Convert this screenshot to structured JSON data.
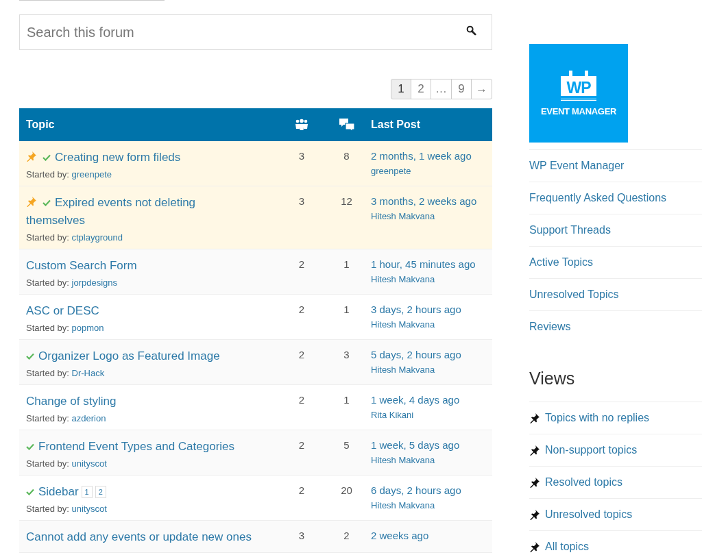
{
  "search": {
    "placeholder": "Search this forum"
  },
  "pagination": [
    {
      "label": "1",
      "selected": true
    },
    {
      "label": "2",
      "selected": false
    },
    {
      "label": "…",
      "selected": false
    },
    {
      "label": "9",
      "selected": false
    },
    {
      "label": "→",
      "selected": false
    }
  ],
  "table": {
    "columns": {
      "topic": "Topic",
      "last_post": "Last Post"
    },
    "rows": [
      {
        "title": "Creating new form fileds",
        "sticky": true,
        "resolved": true,
        "started_by": "Started by:",
        "author": "greenpete",
        "voices": "3",
        "posts": "8",
        "last_post": "2 months, 1 week ago",
        "last_post_author": "greenpete"
      },
      {
        "title": "Expired events not deleting themselves",
        "sticky": true,
        "resolved": true,
        "started_by": "Started by:",
        "author": "ctplayground",
        "voices": "3",
        "posts": "12",
        "last_post": "3 months, 2 weeks ago",
        "last_post_author": "Hitesh Makvana"
      },
      {
        "title": "Custom Search Form",
        "sticky": false,
        "resolved": false,
        "started_by": "Started by:",
        "author": "jorpdesigns",
        "voices": "2",
        "posts": "1",
        "last_post": "1 hour, 45 minutes ago",
        "last_post_author": "Hitesh Makvana"
      },
      {
        "title": "ASC or DESC",
        "sticky": false,
        "resolved": false,
        "started_by": "Started by:",
        "author": "popmon",
        "voices": "2",
        "posts": "1",
        "last_post": "3 days, 2 hours ago",
        "last_post_author": "Hitesh Makvana"
      },
      {
        "title": "Organizer Logo as Featured Image",
        "sticky": false,
        "resolved": true,
        "started_by": "Started by:",
        "author": "Dr-Hack",
        "voices": "2",
        "posts": "3",
        "last_post": "5 days, 2 hours ago",
        "last_post_author": "Hitesh Makvana"
      },
      {
        "title": "Change of styling",
        "sticky": false,
        "resolved": false,
        "started_by": "Started by:",
        "author": "azderion",
        "voices": "2",
        "posts": "1",
        "last_post": "1 week, 4 days ago",
        "last_post_author": "Rita Kikani"
      },
      {
        "title": "Frontend Event Types and Categories",
        "sticky": false,
        "resolved": true,
        "started_by": "Started by:",
        "author": "unityscot",
        "voices": "2",
        "posts": "5",
        "last_post": "1 week, 5 days ago",
        "last_post_author": "Hitesh Makvana"
      },
      {
        "title": "Sidebar",
        "sticky": false,
        "resolved": true,
        "pages": [
          "1",
          "2"
        ],
        "started_by": "Started by:",
        "author": "unityscot",
        "voices": "2",
        "posts": "20",
        "last_post": "6 days, 2 hours ago",
        "last_post_author": "Hitesh Makvana"
      },
      {
        "title": "Cannot add any events or update new ones",
        "sticky": false,
        "resolved": false,
        "voices": "3",
        "posts": "2",
        "last_post": "2 weeks ago"
      }
    ]
  },
  "sidebar": {
    "logo": {
      "mark": "WP",
      "name": "EVENT MANAGER"
    },
    "links": [
      "WP Event Manager",
      "Frequently Asked Questions",
      "Support Threads",
      "Active Topics",
      "Unresolved Topics",
      "Reviews"
    ],
    "views_title": "Views",
    "views": [
      "Topics with no replies",
      "Non-support topics",
      "Resolved topics",
      "Unresolved topics",
      "All topics"
    ]
  }
}
